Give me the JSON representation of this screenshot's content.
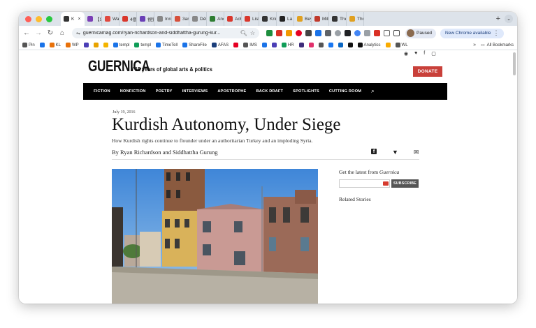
{
  "browser": {
    "tabs": [
      {
        "label": "K",
        "active": true,
        "color": "#333333"
      },
      {
        "label": "【Sta",
        "color": "#7b3fb6"
      },
      {
        "label": "Warn",
        "color": "#e0483e"
      },
      {
        "label": "4個特",
        "color": "#d9372c"
      },
      {
        "label": "視覺",
        "color": "#6a3fb6"
      },
      {
        "label": "Inn S",
        "color": "#888888"
      },
      {
        "label": "3ara",
        "color": "#d6503b"
      },
      {
        "label": "Détra",
        "color": "#888888"
      },
      {
        "label": "Anew",
        "color": "#2e7d32"
      },
      {
        "label": "Achte",
        "color": "#d9372c"
      },
      {
        "label": "Lisbo",
        "color": "#d9372c"
      },
      {
        "label": "Krimi",
        "color": "#333333"
      },
      {
        "label": "La Ul",
        "color": "#222222"
      },
      {
        "label": "Beyo",
        "color": "#e0a020"
      },
      {
        "label": "Mille",
        "color": "#c0392b"
      },
      {
        "label": "The s",
        "color": "#333333"
      },
      {
        "label": "Thre",
        "color": "#e0a020"
      }
    ],
    "tab_active_close": "×",
    "new_tab": "+",
    "tab_search": "⌄",
    "url": "guernicamag.com/ryan-richardson-and-siddhattha-gurung-kur...",
    "profile_status": "Paused",
    "update_label": "New Chrome available",
    "bookmarks": [
      {
        "label": "Pin",
        "color": "#555555"
      },
      {
        "label": "",
        "color": "#1a73e8"
      },
      {
        "label": "KL",
        "color": "#e8710a"
      },
      {
        "label": "WP",
        "color": "#e8710a"
      },
      {
        "label": "",
        "color": "#4b3fb6"
      },
      {
        "label": "",
        "color": "#e8a300"
      },
      {
        "label": "",
        "color": "#f4b400"
      },
      {
        "label": "templ",
        "color": "#1a73e8"
      },
      {
        "label": "templ",
        "color": "#0f9d58"
      },
      {
        "label": "TimeTell",
        "color": "#1a73e8"
      },
      {
        "label": "ShareFile",
        "color": "#1a73e8"
      },
      {
        "label": "AFAS",
        "color": "#1a3d7a"
      },
      {
        "label": "",
        "color": "#e60023"
      },
      {
        "label": "IMS",
        "color": "#555555"
      },
      {
        "label": "",
        "color": "#1a73e8"
      },
      {
        "label": "",
        "color": "#4b3fb6"
      },
      {
        "label": "HR",
        "color": "#0f9d58"
      },
      {
        "label": "",
        "color": "#3d2b7a"
      },
      {
        "label": "",
        "color": "#e1306c"
      },
      {
        "label": "",
        "color": "#555555"
      },
      {
        "label": "",
        "color": "#1877f2"
      },
      {
        "label": "",
        "color": "#0a66c2"
      },
      {
        "label": "",
        "color": "#111111"
      },
      {
        "label": "Analytics",
        "color": "#111111"
      },
      {
        "label": "",
        "color": "#f9ab00"
      },
      {
        "label": "WL",
        "color": "#555555"
      }
    ],
    "bookmarks_more": "»",
    "all_bookmarks": "All Bookmarks"
  },
  "site": {
    "logo": "GUERNICA",
    "tagline": "/ 15 years of global arts & politics",
    "donate": "DONATE",
    "nav": [
      "FICTION",
      "NONFICTION",
      "POETRY",
      "INTERVIEWS",
      "APOSTROPHE",
      "BACK DRAFT",
      "SPOTLIGHTS",
      "CUTTING ROOM"
    ]
  },
  "article": {
    "date": "July 19, 2016",
    "title": "Kurdish Autonomy, Under Siege",
    "dek": "How Kurdish rights continue to flounder under an authoritarian Turkey and an imploding Syria.",
    "byline": "By Ryan Richardson and Siddhattha Gurung"
  },
  "sidebar": {
    "newsletter_prefix": "Get the latest from ",
    "newsletter_brand": "Guernica",
    "subscribe": "SUBSCRIBE",
    "related": "Related Stories"
  }
}
